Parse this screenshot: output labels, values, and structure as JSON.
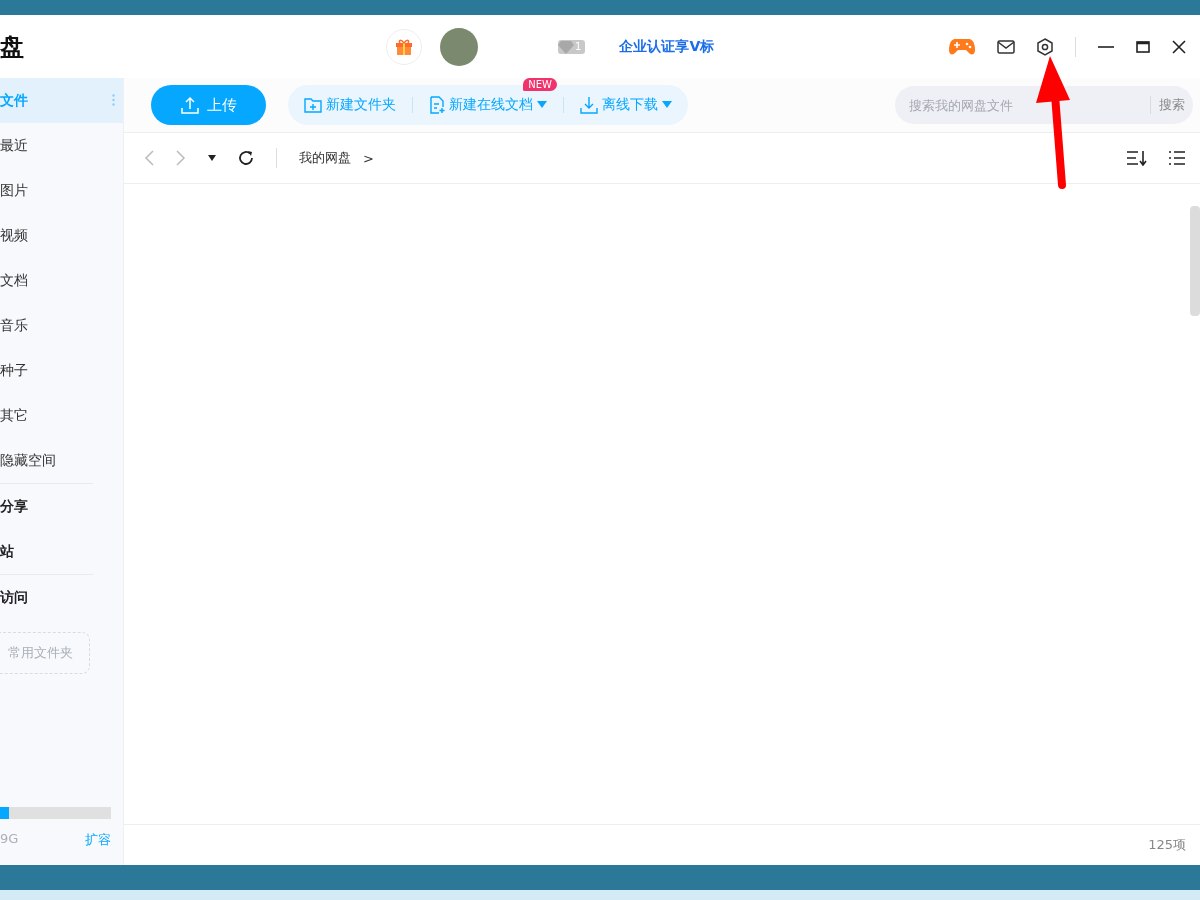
{
  "header": {
    "title": "盘",
    "level_badge": "1",
    "promo_link": "企业认证享V标"
  },
  "toolbar": {
    "upload_button": "上传",
    "actions": [
      {
        "kind": "folder",
        "label": "新建文件夹",
        "dropdown": false
      },
      {
        "kind": "document",
        "label": "新建在线文档",
        "dropdown": true,
        "badge": "NEW"
      },
      {
        "kind": "download",
        "label": "离线下载",
        "dropdown": true
      }
    ],
    "search": {
      "placeholder": "搜索我的网盘文件",
      "button": "搜索"
    }
  },
  "navigation": {
    "breadcrumb": [
      "我的网盘"
    ],
    "separator": ">"
  },
  "sidebar": {
    "groups": [
      [
        {
          "kind": "main",
          "label": "文件",
          "selected": true
        },
        {
          "kind": "sub",
          "label": "最近",
          "selected": false
        },
        {
          "kind": "sub",
          "label": "图片",
          "selected": false
        },
        {
          "kind": "sub",
          "label": "视频",
          "selected": false
        },
        {
          "kind": "sub",
          "label": "文档",
          "selected": false
        },
        {
          "kind": "sub",
          "label": "音乐",
          "selected": false
        },
        {
          "kind": "sub",
          "label": "种子",
          "selected": false
        },
        {
          "kind": "sub",
          "label": "其它",
          "selected": false
        },
        {
          "kind": "sub",
          "label": "隐藏空间",
          "selected": false
        }
      ],
      [
        {
          "kind": "main",
          "label": "分享",
          "selected": false
        },
        {
          "kind": "main",
          "label": "站",
          "selected": false
        }
      ],
      [
        {
          "kind": "main",
          "label": "访问",
          "selected": false
        },
        {
          "kind": "add",
          "label": "常用文件夹",
          "selected": false
        }
      ]
    ]
  },
  "storage": {
    "level": 0.08,
    "usage": "9G",
    "expand_link": "扩容"
  },
  "status_bar": {
    "item_count": "125项"
  }
}
